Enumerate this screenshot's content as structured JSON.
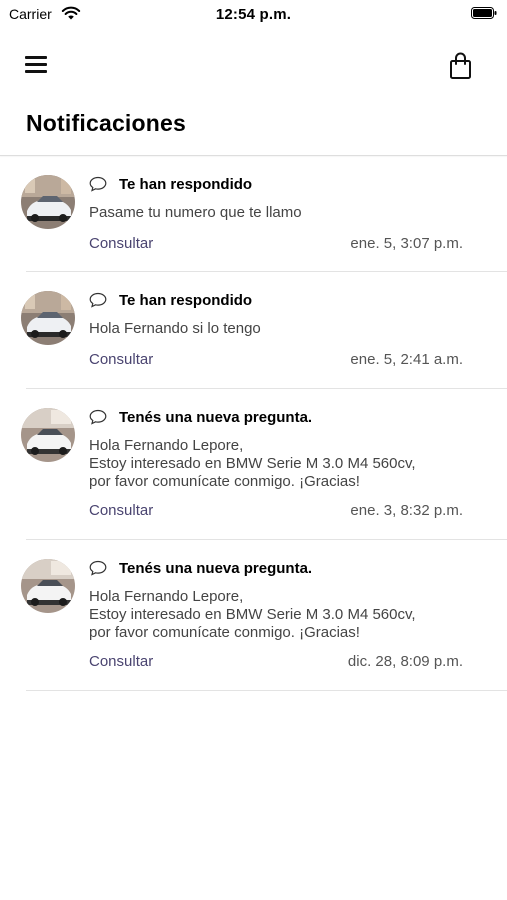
{
  "status_bar": {
    "carrier": "Carrier",
    "time": "12:54 p.m."
  },
  "nav": {
    "menu_icon": "hamburger-menu-icon",
    "cart_icon": "shopping-bag-icon"
  },
  "page": {
    "title": "Notificaciones"
  },
  "notifications": [
    {
      "title": "Te han respondido",
      "message": "Pasame tu numero que te llamo",
      "action": "Consultar",
      "timestamp": "ene. 5, 3:07 p.m."
    },
    {
      "title": "Te han respondido",
      "message": "Hola Fernando si lo tengo",
      "action": "Consultar",
      "timestamp": "ene. 5, 2:41 a.m."
    },
    {
      "title": "Tenés una nueva pregunta.",
      "message": "Hola Fernando Lepore,\nEstoy interesado en BMW Serie M 3.0 M4 560cv,\npor favor comunícate conmigo. ¡Gracias!",
      "action": "Consultar",
      "timestamp": "ene. 3, 8:32 p.m."
    },
    {
      "title": "Tenés una nueva pregunta.",
      "message": "Hola Fernando Lepore,\nEstoy interesado en BMW Serie M 3.0 M4 560cv,\npor favor comunícate conmigo. ¡Gracias!",
      "action": "Consultar",
      "timestamp": "dic. 28, 8:09 p.m."
    }
  ],
  "colors": {
    "link": "#4a4470",
    "divider": "#e3e3e3"
  }
}
